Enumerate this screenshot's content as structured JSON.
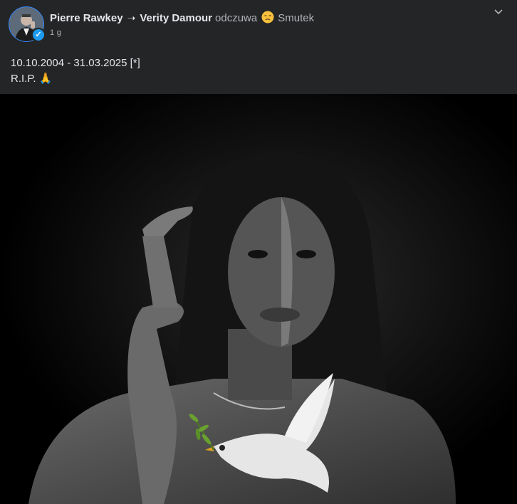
{
  "post": {
    "author": "Pierre Rawkey",
    "arrow": "➝",
    "target": "Verity Damour",
    "feeling_verb": "odczuwa",
    "feeling_icon": "sad-face-icon",
    "feeling": "Smutek",
    "time": "1 g",
    "more_icon": "chevron-down-icon",
    "text_line1": "10.10.2004 - 31.03.2025 [*]",
    "text_line2": "R.I.P. 🙏"
  },
  "colors": {
    "background": "#242526",
    "text": "#e4e6eb",
    "secondary": "#b0b3b8",
    "verified": "#1d9bf0",
    "photo_bg": "#000000"
  }
}
